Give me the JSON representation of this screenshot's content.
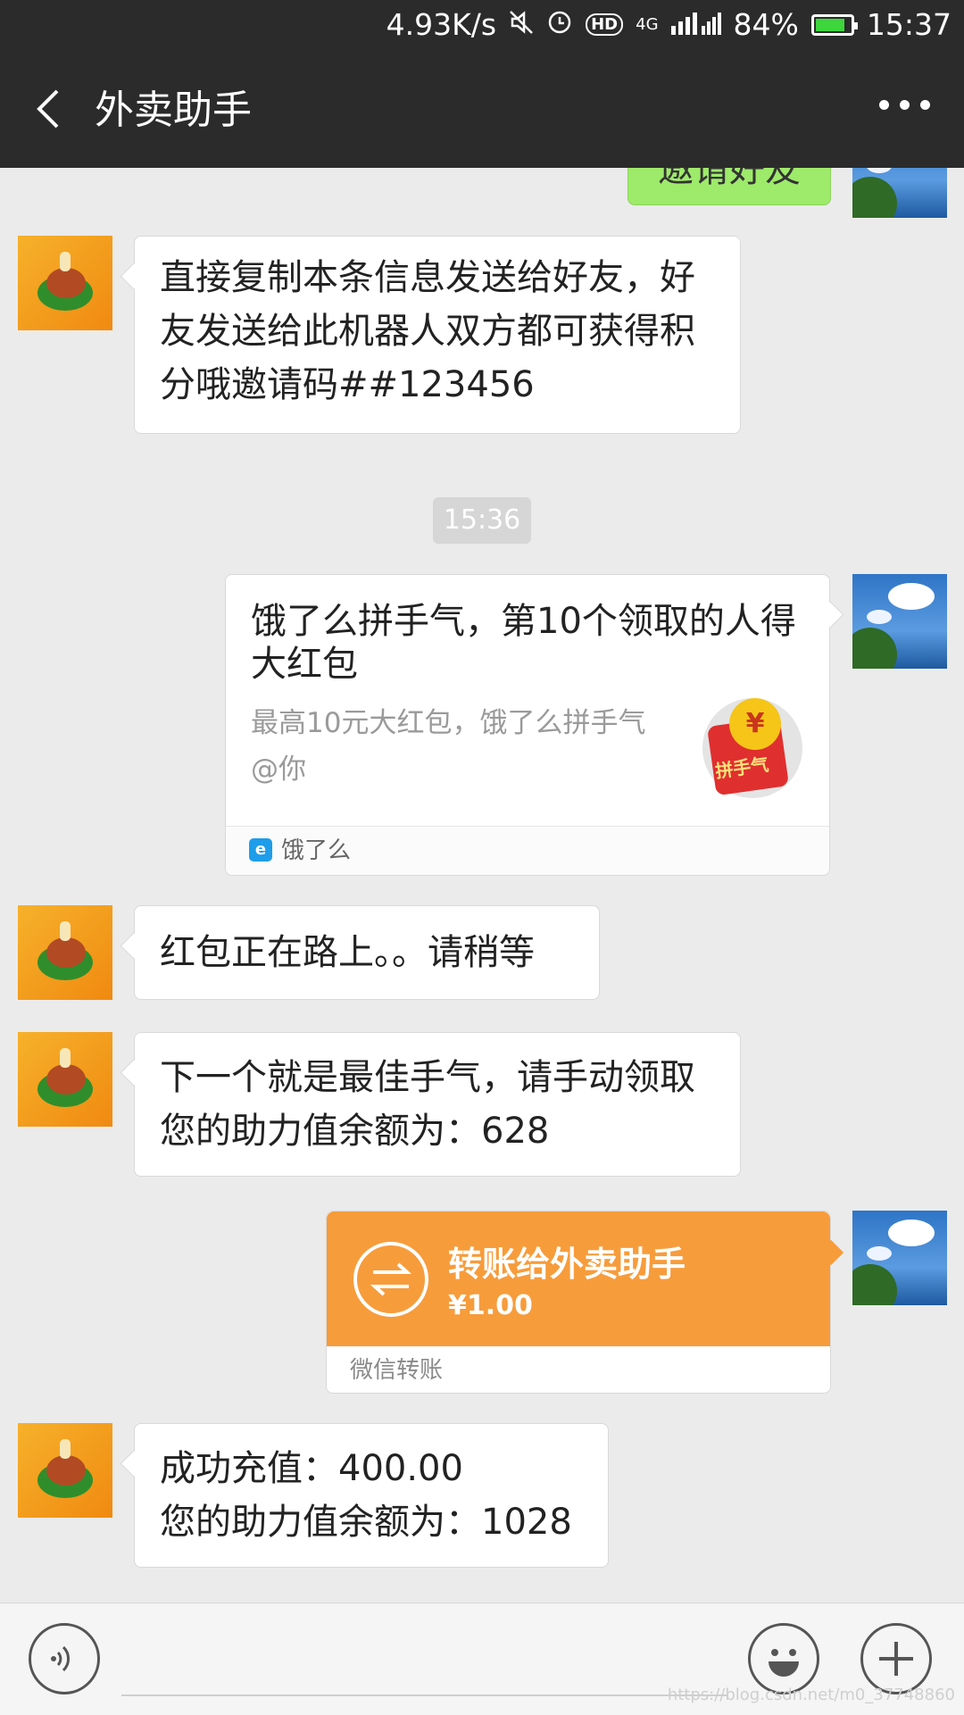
{
  "status_bar": {
    "speed": "4.93K/s",
    "network": "4G",
    "battery": "84%",
    "battery_level": 0.84,
    "time": "15:37",
    "icons": [
      "mute-icon",
      "alarm-icon",
      "hd-icon",
      "signal-icon",
      "battery-icon"
    ]
  },
  "header": {
    "title": "外卖助手"
  },
  "messages": {
    "partial_top": "邀请好友",
    "msg1": [
      "直接复制本条信息发送给好友，好",
      "友发送给此机器人双方都可获得积",
      "分哦邀请码##123456"
    ],
    "timestamp": "15:36",
    "share_card": {
      "title": "饿了么拼手气，第10个领取的人得大红包",
      "desc": "最高10元大红包，饿了么拼手气@你",
      "badge": "拼手气",
      "coin": "¥",
      "source": "饿了么",
      "source_icon_letter": "e"
    },
    "msg2": "红包正在路上。。请稍等",
    "msg3": [
      "下一个就是最佳手气，请手动领取",
      "您的助力值余额为：628"
    ],
    "transfer": {
      "title": "转账给外卖助手",
      "amount": "¥1.00",
      "footer": "微信转账"
    },
    "msg4": [
      "成功充值：400.00",
      "您的助力值余额为：1028"
    ]
  },
  "watermark": "https://blog.csdn.net/m0_37748860",
  "colors": {
    "header_bg": "#2b2b2b",
    "chat_bg": "#ebebeb",
    "transfer_orange": "#f79c3b",
    "sent_green": "#9eea6a"
  }
}
